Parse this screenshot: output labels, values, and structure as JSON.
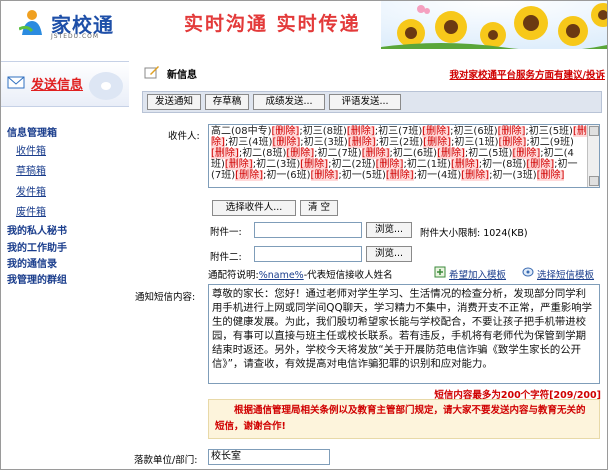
{
  "header": {
    "logo_text": "家校通",
    "logo_sub": "JSTEDU.COM",
    "slogan": "实时沟通  实时传递"
  },
  "sidebar": {
    "send_label": "发送信息",
    "sections": [
      {
        "label": "信息管理箱",
        "sub": [
          "收件箱",
          "草稿箱",
          "发件箱",
          "废件箱"
        ]
      },
      {
        "label": "我的私人秘书"
      },
      {
        "label": "我的工作助手"
      },
      {
        "label": "我的通信录"
      },
      {
        "label": "我管理的群组"
      }
    ]
  },
  "main": {
    "title": "新信息",
    "suggest_link": "我对家校通平台服务方面有建议/投诉",
    "toolbar": [
      "发送通知",
      "存草稿",
      "成绩发送...",
      "评语发送..."
    ],
    "recipient_label": "收件人:",
    "recipients": [
      "高二(08中专)",
      "初三(8班)",
      "初三(7班)",
      "初三(6班)",
      "初三(5班)",
      "初三(4班)",
      "初三(3班)",
      "初三(2班)",
      "初三(1班)",
      "初二(9班)",
      "初二(8班)",
      "初二(7班)",
      "初二(6班)",
      "初二(5班)",
      "初二(4班)",
      "初二(3班)",
      "初二(2班)",
      "初二(1班)",
      "初一(8班)",
      "初一(7班)",
      "初一(6班)",
      "初一(5班)",
      "初一(4班)",
      "初一(3班)"
    ],
    "delete_tag": "[删除]",
    "select_recipient_btn": "选择收件人...",
    "clear_btn": "清 空",
    "attach1_label": "附件一:",
    "attach2_label": "附件二:",
    "browse_btn": "浏览...",
    "size_limit": "附件大小限制: 1024(KB)",
    "placeholder_hint_prefix": "通配符说明:",
    "placeholder_var": "%name%",
    "placeholder_hint_suffix": "-代表短信接收人姓名",
    "add_template": "希望加入模板",
    "select_template": "选择短信模板",
    "content_label": "通知短信内容:",
    "content": "尊敬的家长：您好！通过老师对学生学习、生活情况的检查分析，发现部分同学利用手机进行上网或同学间QQ聊天，学习精力不集中，消费开支不正常，严重影响学生的健康发展。为此，我们殷切希望家长能与学校配合，不要让孩子把手机带进校园，有事可以直接与班主任或校长联系。若有违反，手机将有老师代为保管到学期结束时返还。另外，学校今天将发放“关于开展防范电信诈骗《致学生家长的公开信》”，请查收，有效提高对电信诈骗犯罪的识别和应对能力。",
    "counter": "短信内容最多为200个字符[209/200]",
    "notice": "根据通信管理局相关条例以及教育主管部门规定，请大家不要发送内容与教育无关的短信，谢谢合作!",
    "sender_label": "落款单位/部门:",
    "sender_value": "校长室"
  }
}
